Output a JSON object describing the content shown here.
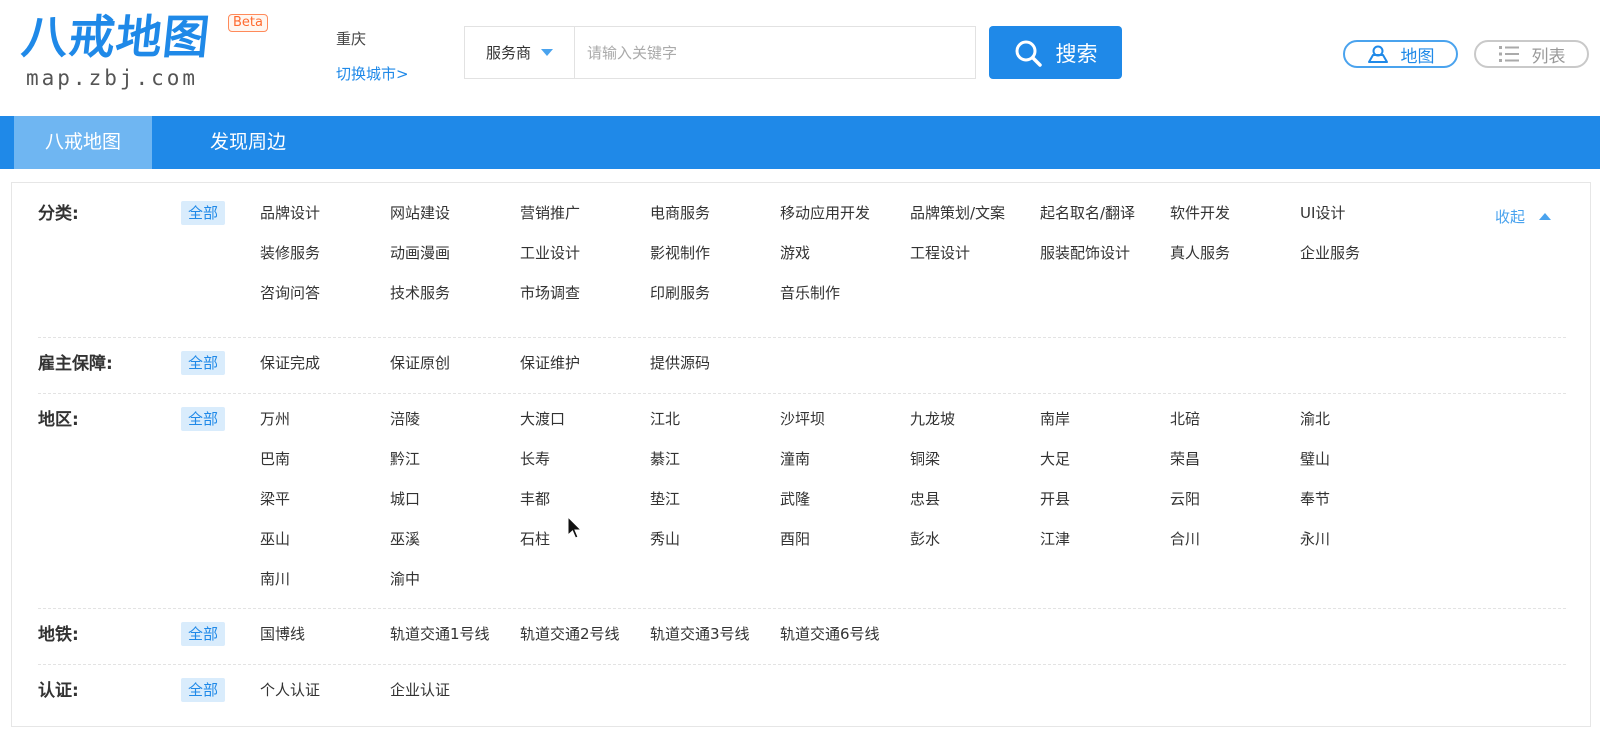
{
  "header": {
    "logo_title": "八戒地图",
    "logo_domain": "map.zbj.com",
    "logo_badge": "Beta",
    "city": "重庆",
    "city_switch": "切换城市>",
    "search": {
      "type_label": "服务商",
      "placeholder": "请输入关键字",
      "value": "",
      "button_label": "搜索"
    },
    "view_map_label": "地图",
    "view_list_label": "列表"
  },
  "nav": {
    "tabs": [
      {
        "label": "八戒地图",
        "active": true
      },
      {
        "label": "发现周边",
        "active": false
      }
    ]
  },
  "filters": {
    "all_label": "全部",
    "collapse_label": "收起",
    "category": {
      "label": "分类:",
      "items": [
        "品牌设计",
        "网站建设",
        "营销推广",
        "电商服务",
        "移动应用开发",
        "品牌策划/文案",
        "起名取名/翻译",
        "软件开发",
        "UI设计",
        "装修服务",
        "动画漫画",
        "工业设计",
        "影视制作",
        "游戏",
        "工程设计",
        "服装配饰设计",
        "真人服务",
        "企业服务",
        "咨询问答",
        "技术服务",
        "市场调查",
        "印刷服务",
        "音乐制作"
      ]
    },
    "guarantee": {
      "label": "雇主保障:",
      "items": [
        "保证完成",
        "保证原创",
        "保证维护",
        "提供源码"
      ]
    },
    "region": {
      "label": "地区:",
      "items": [
        "万州",
        "涪陵",
        "大渡口",
        "江北",
        "沙坪坝",
        "九龙坡",
        "南岸",
        "北碚",
        "渝北",
        "巴南",
        "黔江",
        "长寿",
        "綦江",
        "潼南",
        "铜梁",
        "大足",
        "荣昌",
        "璧山",
        "梁平",
        "城口",
        "丰都",
        "垫江",
        "武隆",
        "忠县",
        "开县",
        "云阳",
        "奉节",
        "巫山",
        "巫溪",
        "石柱",
        "秀山",
        "酉阳",
        "彭水",
        "江津",
        "合川",
        "永川",
        "南川",
        "渝中"
      ]
    },
    "metro": {
      "label": "地铁:",
      "items": [
        "国博线",
        "轨道交通1号线",
        "轨道交通2号线",
        "轨道交通3号线",
        "轨道交通6号线"
      ]
    },
    "certification": {
      "label": "认证:",
      "items": [
        "个人认证",
        "企业认证"
      ]
    }
  },
  "colors": {
    "brand_blue": "#1f89e8",
    "nav_active": "#6fb6f2",
    "badge_orange": "#ff6a2f"
  }
}
